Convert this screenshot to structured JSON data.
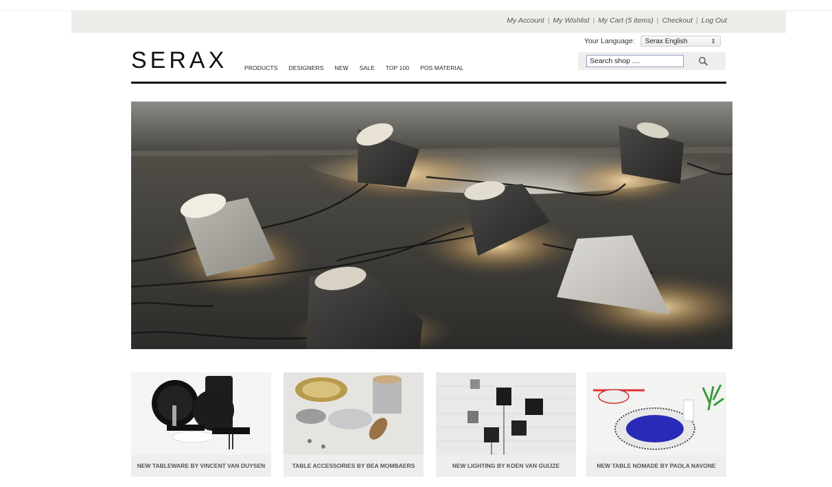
{
  "header": {
    "account_links": [
      "My Account",
      "My Wishlist",
      "My Cart (5 items)",
      "Checkout",
      "Log Out"
    ],
    "language_label": "Your Language:",
    "language_value": "Serax English",
    "logo_text": "SERAX",
    "nav": [
      "PRODUCTS",
      "DESIGNERS",
      "NEW",
      "SALE",
      "TOP 100",
      "POS MATERIAL"
    ],
    "search_placeholder": "Search shop ....",
    "search_icon": "magnifier-icon"
  },
  "hero": {
    "image": "concrete-floor-lamps-photo"
  },
  "tiles": [
    {
      "caption": "NEW TABLEWARE BY VINCENT VAN DUYSEN"
    },
    {
      "caption": "TABLE ACCESSORIES BY BEA MOMBAERS"
    },
    {
      "caption": "NEW LIGHTING BY KOEN VAN GUIJZE"
    },
    {
      "caption": "NEW TABLE NOMADE BY PAOLA NAVONE"
    }
  ],
  "colors": {
    "topbar_bg": "#efeeea",
    "header_rule": "#111111",
    "search_border": "#8ba0c8"
  }
}
